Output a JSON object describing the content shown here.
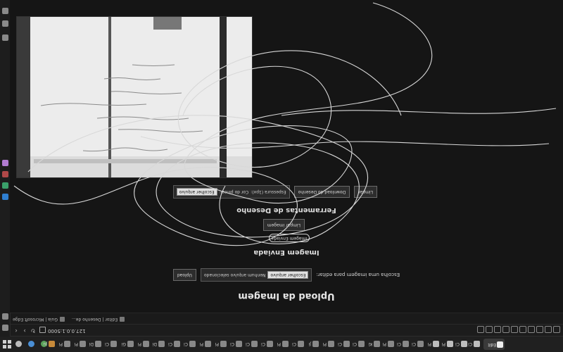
{
  "page": {
    "title": "Upload da Imagem",
    "upload_label": "Escolha uma imagem para editar:",
    "file_button": "Escolher arquivo",
    "file_status": "Nenhum arquivo selecionado",
    "upload_button": "Upload",
    "sent_section": "Imagem Enviada",
    "sent_pill": "Imagem Enviada",
    "clear_button": "Limpar imagem",
    "draw_section": "Ferramentas de Desenho",
    "color_label": "Cor do pincel:",
    "size_label": "Espessura (1px):",
    "clear_draw_button": "Limpar",
    "download_button": "Download do Desenho",
    "download_file_button": "Escolher arquivo"
  },
  "browser": {
    "url": "127.0.0.1:5000",
    "favorites": [
      "Guia | Microsoft Edge",
      "Editor | Desenho de..."
    ]
  },
  "taskbar": {
    "apps": [
      "Explorer",
      "Edge",
      "Chrome",
      "VS Code",
      "Terminal",
      "Teams",
      "Outlook",
      "Spotify",
      "Files",
      "Notepad"
    ],
    "open_windows": [
      "Ju",
      "Di",
      "Pi",
      "Gi",
      "Ci",
      "Di",
      "Pi",
      "Pi",
      "Ci",
      "Ci",
      "Ci",
      "Pi",
      "Ci",
      "Ji",
      "Pi",
      "Ci",
      "Ci",
      "Ki",
      "Ci",
      "Ci",
      "Ci",
      "Pi",
      "Pi",
      "Ci",
      "Ed"
    ],
    "active_label": "Edit"
  },
  "canvas_notes": "whiteboard photo with handwritten notes"
}
